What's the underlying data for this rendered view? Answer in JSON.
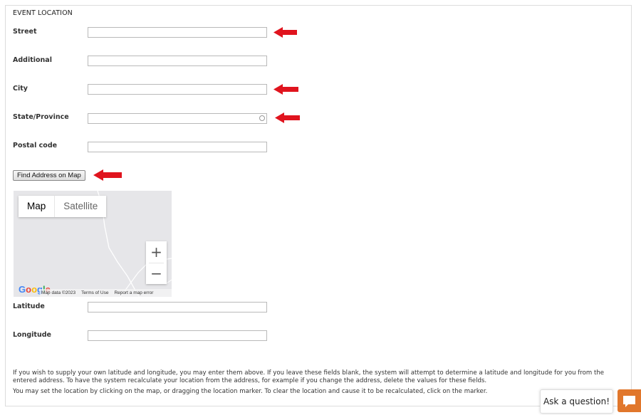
{
  "section": {
    "title": "EVENT LOCATION"
  },
  "fields": {
    "street": {
      "label": "Street",
      "value": ""
    },
    "additional": {
      "label": "Additional",
      "value": ""
    },
    "city": {
      "label": "City",
      "value": ""
    },
    "state": {
      "label": "State/Province",
      "value": ""
    },
    "postal": {
      "label": "Postal code",
      "value": ""
    },
    "latitude": {
      "label": "Latitude",
      "value": ""
    },
    "longitude": {
      "label": "Longitude",
      "value": ""
    }
  },
  "find_button": {
    "label": "Find Address on Map"
  },
  "map": {
    "type_options": [
      "Map",
      "Satellite"
    ],
    "selected_type": "Map",
    "zoom_in": "+",
    "zoom_out": "−",
    "logo": "Google",
    "footer": [
      "Map data ©2023",
      "Terms of Use",
      "Report a map error"
    ]
  },
  "help_text": [
    "If you wish to supply your own latitude and longitude, you may enter them above. If you leave these fields blank, the system will attempt to determine a latitude and longitude for you from the entered address. To have the system recalculate your location from the address, for example if you change the address, delete the values for these fields.",
    "You may set the location by clicking on the map, or dragging the location marker. To clear the location and cause it to be recalculated, click on the marker."
  ],
  "chat": {
    "prompt": "Ask a question!"
  },
  "colors": {
    "arrow": "#e0141e",
    "chat_accent": "#e1772c"
  }
}
